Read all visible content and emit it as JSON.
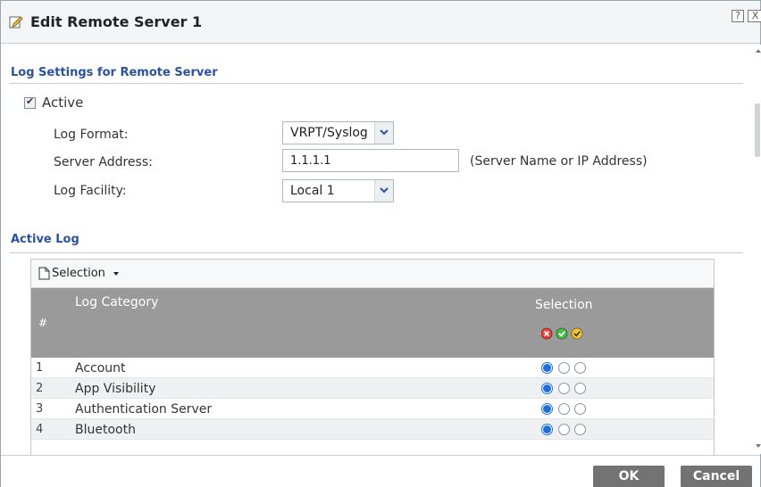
{
  "dialog": {
    "title": "Edit Remote Server 1",
    "help_label": "?",
    "close_label": "X"
  },
  "log_settings": {
    "section_title": "Log Settings for Remote Server",
    "active_label": "Active",
    "active_checked": true,
    "log_format_label": "Log Format:",
    "log_format_value": "VRPT/Syslog",
    "server_address_label": "Server Address:",
    "server_address_value": "1.1.1.1",
    "server_address_hint": "(Server Name or IP Address)",
    "log_facility_label": "Log Facility:",
    "log_facility_value": "Local 1"
  },
  "active_log": {
    "section_title": "Active Log",
    "toolbar": {
      "selection_label": "Selection"
    },
    "headers": {
      "hash": "#",
      "category": "Log Category",
      "selection": "Selection"
    },
    "header_icons": [
      "disable-all-icon",
      "enable-all-icon",
      "normal-all-icon"
    ],
    "rows": [
      {
        "num": "1",
        "name": "Account",
        "selected": 0
      },
      {
        "num": "2",
        "name": "App Visibility",
        "selected": 0
      },
      {
        "num": "3",
        "name": "Authentication Server",
        "selected": 0
      },
      {
        "num": "4",
        "name": "Bluetooth",
        "selected": 0
      }
    ]
  },
  "footer": {
    "ok_label": "OK",
    "cancel_label": "Cancel"
  },
  "colors": {
    "section_title": "#2a52a0",
    "table_header": "#9a9a9a",
    "button": "#737373",
    "radio_on": "#1e6fd9"
  }
}
